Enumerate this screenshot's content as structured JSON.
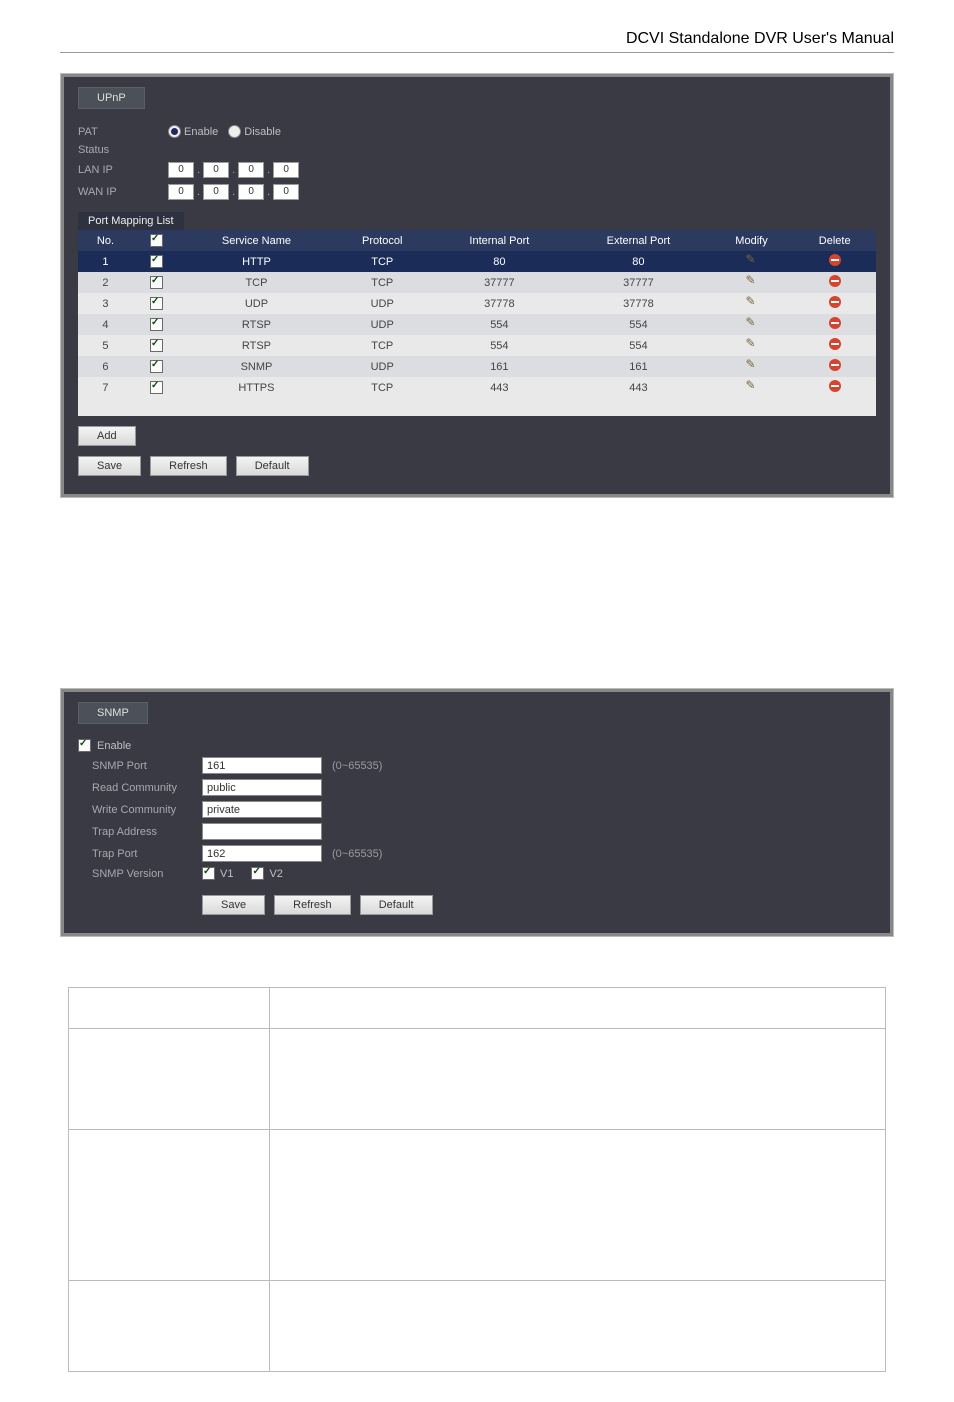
{
  "doc_title": "DCVI Standalone DVR User's Manual",
  "upnp": {
    "tab": "UPnP",
    "labels": {
      "pat": "PAT",
      "enable": "Enable",
      "disable": "Disable",
      "status": "Status",
      "lan_ip": "LAN IP",
      "wan_ip": "WAN IP",
      "port_mapping": "Port Mapping List"
    },
    "lan_ip": [
      "0",
      "0",
      "0",
      "0"
    ],
    "wan_ip": [
      "0",
      "0",
      "0",
      "0"
    ],
    "headers": {
      "no": "No.",
      "chk": "",
      "service": "Service Name",
      "protocol": "Protocol",
      "internal": "Internal Port",
      "external": "External Port",
      "modify": "Modify",
      "delete": "Delete"
    },
    "rows": [
      {
        "no": "1",
        "svc": "HTTP",
        "proto": "TCP",
        "int": "80",
        "ext": "80"
      },
      {
        "no": "2",
        "svc": "TCP",
        "proto": "TCP",
        "int": "37777",
        "ext": "37777"
      },
      {
        "no": "3",
        "svc": "UDP",
        "proto": "UDP",
        "int": "37778",
        "ext": "37778"
      },
      {
        "no": "4",
        "svc": "RTSP",
        "proto": "UDP",
        "int": "554",
        "ext": "554"
      },
      {
        "no": "5",
        "svc": "RTSP",
        "proto": "TCP",
        "int": "554",
        "ext": "554"
      },
      {
        "no": "6",
        "svc": "SNMP",
        "proto": "UDP",
        "int": "161",
        "ext": "161"
      },
      {
        "no": "7",
        "svc": "HTTPS",
        "proto": "TCP",
        "int": "443",
        "ext": "443"
      }
    ],
    "buttons": {
      "add": "Add",
      "save": "Save",
      "refresh": "Refresh",
      "default": "Default"
    }
  },
  "snmp": {
    "tab": "SNMP",
    "enable": "Enable",
    "labels": {
      "port": "SNMP Port",
      "read": "Read Community",
      "write": "Write Community",
      "trap_addr": "Trap Address",
      "trap_port": "Trap Port",
      "version": "SNMP Version"
    },
    "values": {
      "port": "161",
      "read": "public",
      "write": "private",
      "trap_addr": "",
      "trap_port": "162"
    },
    "hint": "(0~65535)",
    "v1": "V1",
    "v2": "V2",
    "buttons": {
      "save": "Save",
      "refresh": "Refresh",
      "default": "Default"
    }
  }
}
